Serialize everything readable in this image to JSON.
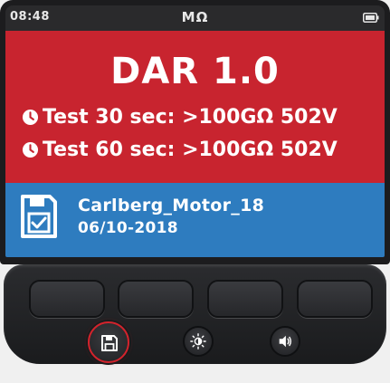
{
  "status_bar": {
    "time": "08:48",
    "unit": "MΩ",
    "battery_icon": "battery-icon"
  },
  "result": {
    "title": "DAR 1.0",
    "lines": [
      {
        "icon": "clock-icon",
        "text": "Test 30 sec: >100GΩ 502V"
      },
      {
        "icon": "clock-icon",
        "text": "Test 60 sec: >100GΩ 502V"
      }
    ]
  },
  "file": {
    "icon": "save-file-icon",
    "name": "Carlberg_Motor_18",
    "date": "06/10-2018"
  },
  "keypad": {
    "soft_keys": 4,
    "round_keys": [
      {
        "icon": "save-icon",
        "active": true
      },
      {
        "icon": "brightness-icon",
        "active": false
      },
      {
        "icon": "speaker-icon",
        "active": false
      }
    ]
  },
  "colors": {
    "result_panel": "#c8242f",
    "file_panel": "#2e7cbf",
    "status_bar": "#2a2a2c",
    "active_key_ring": "#d3232c"
  }
}
